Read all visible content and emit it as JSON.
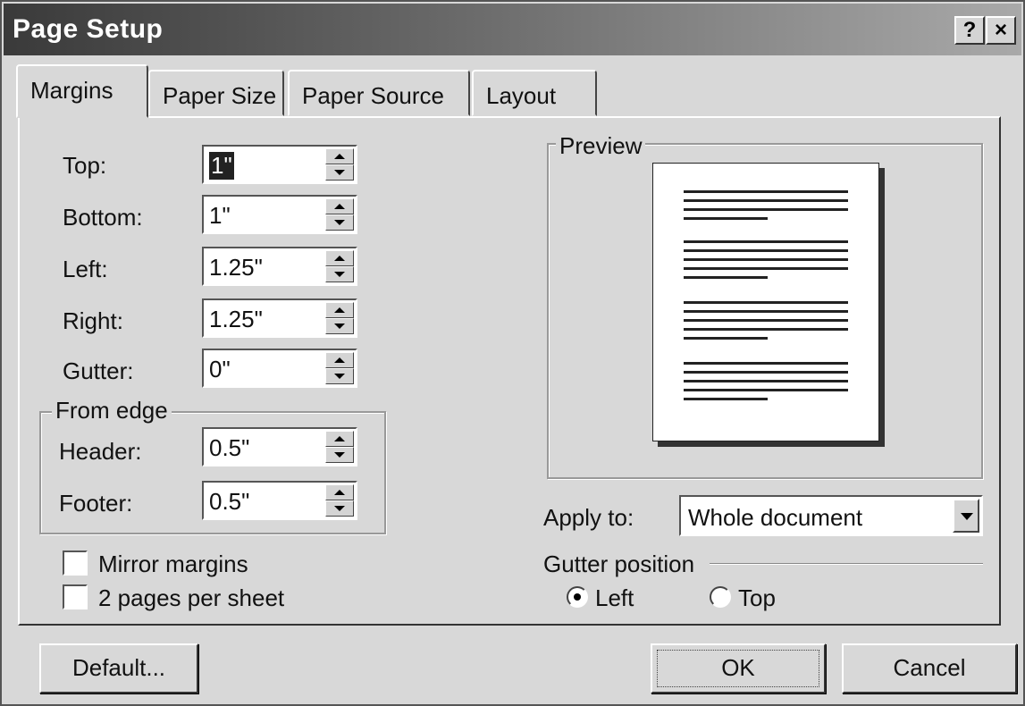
{
  "window": {
    "title": "Page Setup",
    "help_label": "?",
    "close_label": "×"
  },
  "tabs": [
    {
      "label": "Margins",
      "active": true
    },
    {
      "label": "Paper Size",
      "active": false
    },
    {
      "label": "Paper Source",
      "active": false
    },
    {
      "label": "Layout",
      "active": false
    }
  ],
  "margins": {
    "top": {
      "label": "Top:",
      "value": "1\""
    },
    "bottom": {
      "label": "Bottom:",
      "value": "1\""
    },
    "left": {
      "label": "Left:",
      "value": "1.25\""
    },
    "right": {
      "label": "Right:",
      "value": "1.25\""
    },
    "gutter": {
      "label": "Gutter:",
      "value": "0\""
    }
  },
  "from_edge": {
    "title": "From edge",
    "header": {
      "label": "Header:",
      "value": "0.5\""
    },
    "footer": {
      "label": "Footer:",
      "value": "0.5\""
    }
  },
  "options": {
    "mirror_margins": {
      "label": "Mirror margins",
      "checked": false
    },
    "two_pages": {
      "label": "2 pages per sheet",
      "checked": false
    }
  },
  "preview": {
    "title": "Preview"
  },
  "apply_to": {
    "label": "Apply to:",
    "value": "Whole document"
  },
  "gutter_position": {
    "title": "Gutter position",
    "options": [
      {
        "label": "Left",
        "selected": true
      },
      {
        "label": "Top",
        "selected": false
      }
    ]
  },
  "buttons": {
    "default_label": "Default...",
    "ok_label": "OK",
    "cancel_label": "Cancel"
  }
}
